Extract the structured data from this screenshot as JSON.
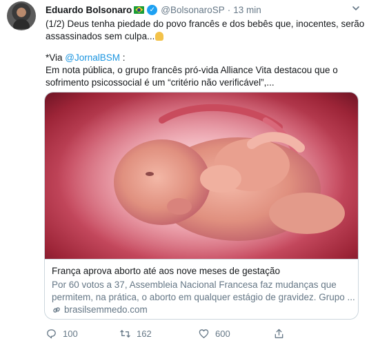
{
  "tweet": {
    "author_name": "Eduardo Bolsonaro",
    "handle": "@BolsonaroSP",
    "separator": "·",
    "time": "13 min",
    "text_lines": [
      "(1/2) Deus tenha piedade do povo francês e dos bebês que, inocentes, serão",
      "assassinados sem culpa..."
    ],
    "via_prefix": "*Via ",
    "via_link": "@JornalBSM",
    "via_suffix": " :",
    "note_lines": [
      "Em nota pública, o grupo francês pró-vida Alliance Vita destacou que o",
      "sofrimento psicossocial é um “critério não verificável”,..."
    ]
  },
  "card": {
    "title": "França aprova aborto até aos nove meses de gestação",
    "description_lines": [
      "Por 60 votos a 37, Assembleia Nacional Francesa faz mudanças que",
      "permitem, na prática, o aborto em qualquer estágio de gravidez. Grupo ..."
    ],
    "domain": "brasilsemmedo.com"
  },
  "actions": {
    "replies": "100",
    "retweets": "162",
    "likes": "600"
  },
  "colors": {
    "link": "#1b95e0",
    "secondary_text": "#657786",
    "verified": "#1da1f2",
    "border": "#ccd6dd"
  },
  "icons": [
    "avatar",
    "brazil-flag-icon",
    "verified-icon",
    "chevron-down-icon",
    "praying-hands-icon",
    "link-icon",
    "reply-icon",
    "retweet-icon",
    "like-icon",
    "share-icon"
  ]
}
